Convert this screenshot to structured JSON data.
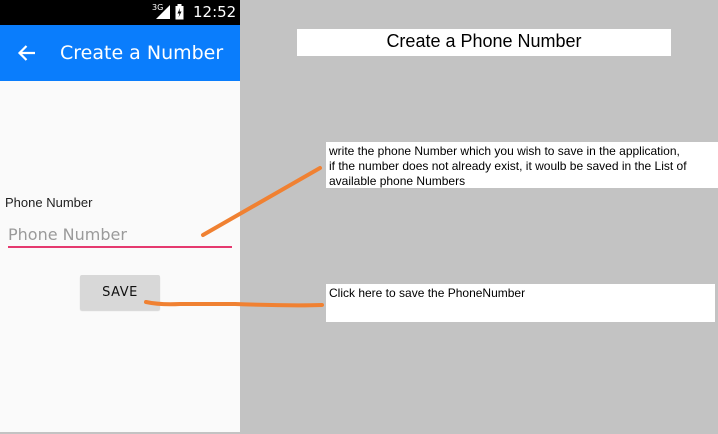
{
  "status_bar": {
    "network": "3G",
    "time": "12:52"
  },
  "app_bar": {
    "title": "Create a Number"
  },
  "form": {
    "field_label": "Phone Number",
    "input_placeholder": "Phone Number",
    "input_value": "",
    "save_label": "SAVE"
  },
  "annotations": {
    "title": "Create a Phone Number",
    "input_note": [
      "write the phone Number which you wish to save in the application,",
      "if the number does not already exist, it woulb be saved in the List of",
      "available phone Numbers"
    ],
    "button_note": "Click here to save the PhoneNumber",
    "connector_color": "#f08132"
  },
  "colors": {
    "app_bar": "#0a7dfc",
    "input_underline": "#e5396f",
    "background": "#c3c3c3"
  }
}
